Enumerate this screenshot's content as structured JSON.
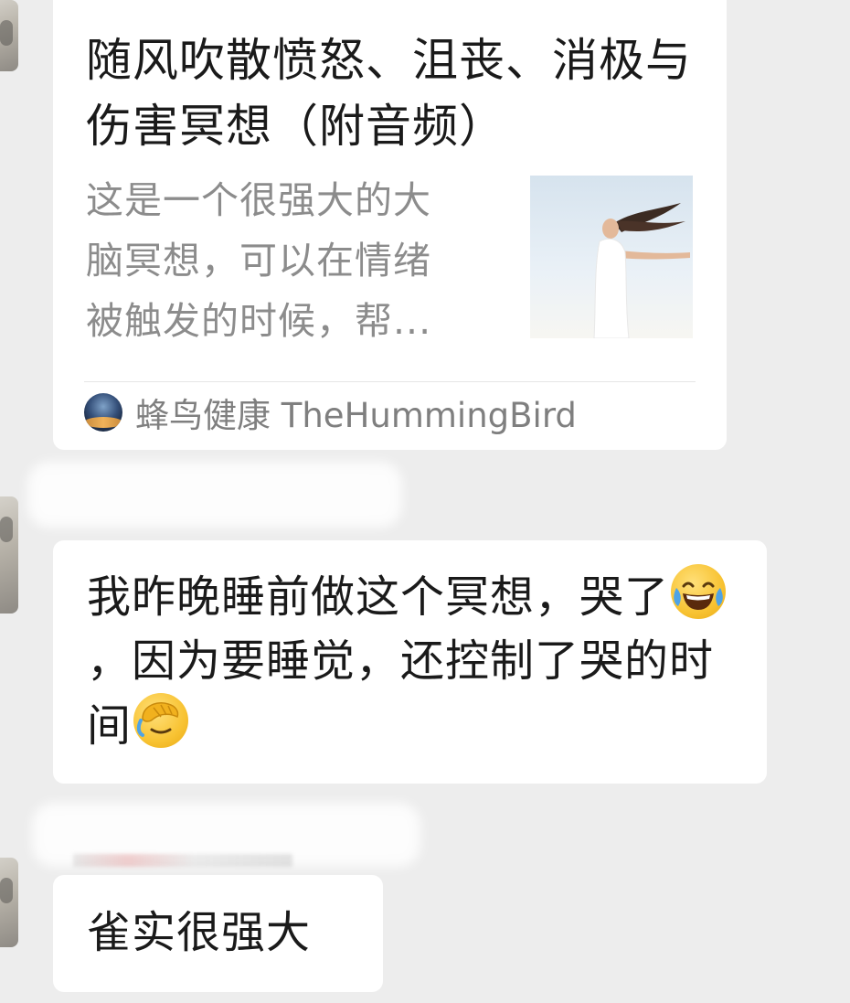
{
  "link_card": {
    "title": "随风吹散愤怒、沮丧、消极与伤害冥想（附音频）",
    "description_lines": [
      "这是一个很强大的大",
      "脑冥想，可以在情绪",
      "被触发的时候，帮..."
    ],
    "source": "蜂鸟健康 TheHummingBird"
  },
  "messages": [
    {
      "part1": "我昨晚睡前做这个冥想，哭了",
      "emoji1": "face-with-tears-of-joy",
      "part2": "，因为要睡觉，还控制了哭的时间",
      "emoji2": "face-palm"
    },
    {
      "text": "雀实很强大"
    }
  ],
  "colors": {
    "background": "#ededed",
    "bubble": "#ffffff",
    "title_text": "#1a1a1a",
    "desc_text": "#8c8c8c",
    "source_text": "#7f7f7f"
  }
}
